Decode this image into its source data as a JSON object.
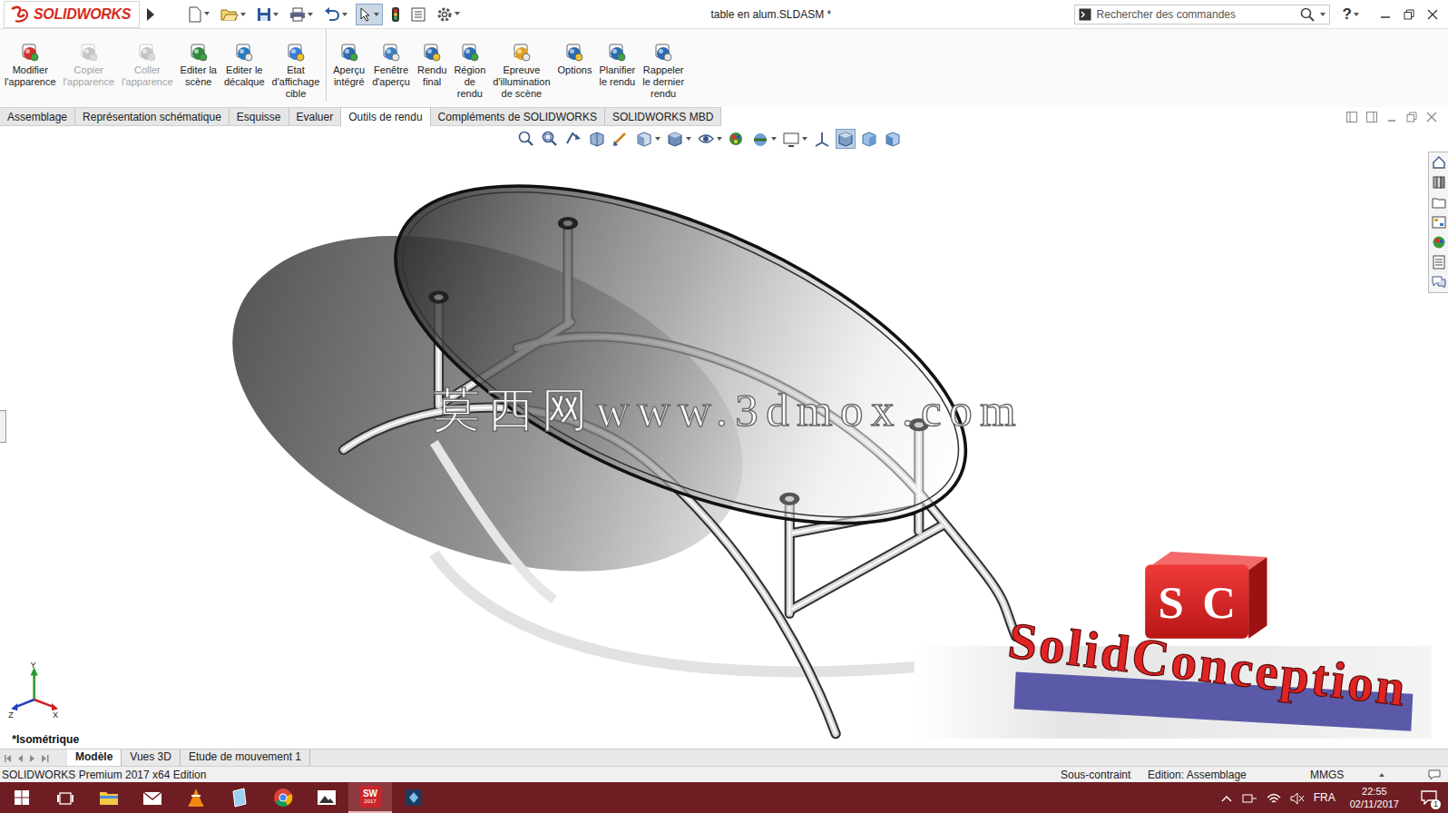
{
  "window": {
    "title": "table en alum.SLDASM *"
  },
  "app_logo": {
    "text": "SOLIDWORKS"
  },
  "search": {
    "placeholder": "Rechercher des commandes"
  },
  "help": {
    "label": "?"
  },
  "ribbon": {
    "groups": [
      {
        "items": [
          {
            "label": [
              "Modifier",
              "l'apparence"
            ],
            "disabled": false
          },
          {
            "label": [
              "Copier",
              "l'apparence"
            ],
            "disabled": true
          },
          {
            "label": [
              "Coller",
              "l'apparence"
            ],
            "disabled": true
          },
          {
            "label": [
              "Editer la",
              "scène"
            ],
            "disabled": false
          },
          {
            "label": [
              "Editer le",
              "décalque"
            ],
            "disabled": false
          },
          {
            "label": [
              "Etat",
              "d'affichage",
              "cible"
            ],
            "disabled": false
          }
        ]
      },
      {
        "items": [
          {
            "label": [
              "Aperçu",
              "intégré"
            ],
            "disabled": false
          },
          {
            "label": [
              "Fenêtre",
              "d'aperçu"
            ],
            "disabled": false
          },
          {
            "label": [
              "Rendu",
              "final"
            ],
            "disabled": false
          },
          {
            "label": [
              "Région",
              "de",
              "rendu"
            ],
            "disabled": false
          },
          {
            "label": [
              "Epreuve",
              "d'illumination",
              "de scène"
            ],
            "disabled": false
          },
          {
            "label": [
              "Options"
            ],
            "disabled": false
          },
          {
            "label": [
              "Planifier",
              "le rendu"
            ],
            "disabled": false
          },
          {
            "label": [
              "Rappeler",
              "le dernier",
              "rendu"
            ],
            "disabled": false
          }
        ]
      }
    ]
  },
  "tabs": [
    {
      "label": "Assemblage",
      "selected": false
    },
    {
      "label": "Représentation schématique",
      "selected": false
    },
    {
      "label": "Esquisse",
      "selected": false
    },
    {
      "label": "Evaluer",
      "selected": false
    },
    {
      "label": "Outils de rendu",
      "selected": true
    },
    {
      "label": "Compléments de SOLIDWORKS",
      "selected": false
    },
    {
      "label": "SOLIDWORKS MBD",
      "selected": false
    }
  ],
  "viewport": {
    "view_name": "*Isométrique",
    "watermark": "莫西网www.3dmox.com",
    "logo": {
      "badge": "SC",
      "name": "SolidConception"
    },
    "triad": {
      "x": "X",
      "y": "Y",
      "z": "Z"
    }
  },
  "bottom_tabs": [
    {
      "label": "Modèle",
      "selected": true
    },
    {
      "label": "Vues 3D",
      "selected": false
    },
    {
      "label": "Etude de mouvement 1",
      "selected": false
    }
  ],
  "status_bar": [
    "SOLIDWORKS Premium 2017 x64 Edition",
    "Sous-contraint",
    "Edition: Assemblage",
    "MMGS"
  ],
  "taskbar": {
    "sw_label": "SW",
    "sw_year": "2017",
    "language": "FRA",
    "time": "22:55",
    "date": "02/11/2017",
    "notifications": "1"
  }
}
